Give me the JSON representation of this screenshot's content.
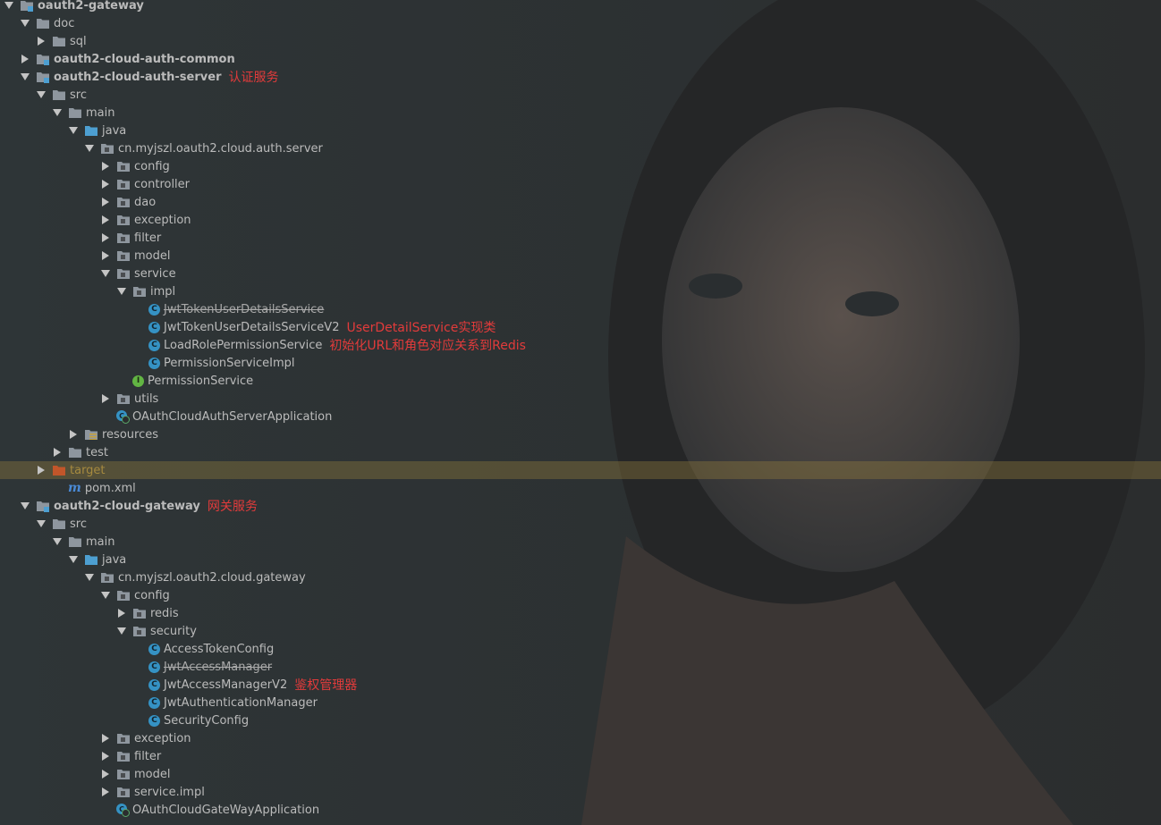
{
  "colors": {
    "annotation": "#e23b3b",
    "folder": "#8e969e",
    "source_folder": "#4d9fd1",
    "excluded_folder": "#c2562a",
    "class_icon": "#3592c4",
    "interface_icon": "#62b543",
    "selected_row": "#7d6b3c"
  },
  "tree": [
    {
      "label": "oauth2-gateway",
      "depth": 0,
      "arrow": "down",
      "icon": "module-folder-icon",
      "bold": true
    },
    {
      "label": "doc",
      "depth": 1,
      "arrow": "down",
      "icon": "folder-icon"
    },
    {
      "label": "sql",
      "depth": 2,
      "arrow": "right",
      "icon": "folder-icon"
    },
    {
      "label": "oauth2-cloud-auth-common",
      "depth": 1,
      "arrow": "right",
      "icon": "module-folder-icon",
      "bold": true
    },
    {
      "label": "oauth2-cloud-auth-server",
      "depth": 1,
      "arrow": "down",
      "icon": "module-folder-icon",
      "bold": true,
      "note": "认证服务"
    },
    {
      "label": "src",
      "depth": 2,
      "arrow": "down",
      "icon": "folder-icon"
    },
    {
      "label": "main",
      "depth": 3,
      "arrow": "down",
      "icon": "folder-icon"
    },
    {
      "label": "java",
      "depth": 4,
      "arrow": "down",
      "icon": "source-folder-icon"
    },
    {
      "label": "cn.myjszl.oauth2.cloud.auth.server",
      "depth": 5,
      "arrow": "down",
      "icon": "package-icon"
    },
    {
      "label": "config",
      "depth": 6,
      "arrow": "right",
      "icon": "package-icon"
    },
    {
      "label": "controller",
      "depth": 6,
      "arrow": "right",
      "icon": "package-icon"
    },
    {
      "label": "dao",
      "depth": 6,
      "arrow": "right",
      "icon": "package-icon"
    },
    {
      "label": "exception",
      "depth": 6,
      "arrow": "right",
      "icon": "package-icon"
    },
    {
      "label": "filter",
      "depth": 6,
      "arrow": "right",
      "icon": "package-icon"
    },
    {
      "label": "model",
      "depth": 6,
      "arrow": "right",
      "icon": "package-icon"
    },
    {
      "label": "service",
      "depth": 6,
      "arrow": "down",
      "icon": "package-icon"
    },
    {
      "label": "impl",
      "depth": 7,
      "arrow": "down",
      "icon": "package-icon"
    },
    {
      "label": "JwtTokenUserDetailsService",
      "depth": 8,
      "arrow": "none",
      "icon": "class-icon",
      "strike": true
    },
    {
      "label": "JwtTokenUserDetailsServiceV2",
      "depth": 8,
      "arrow": "none",
      "icon": "class-icon",
      "note": "UserDetailService实现类"
    },
    {
      "label": "LoadRolePermissionService",
      "depth": 8,
      "arrow": "none",
      "icon": "class-icon",
      "note": "初始化URL和角色对应关系到Redis"
    },
    {
      "label": "PermissionServiceImpl",
      "depth": 8,
      "arrow": "none",
      "icon": "class-icon"
    },
    {
      "label": "PermissionService",
      "depth": 7,
      "arrow": "none",
      "icon": "interface-icon"
    },
    {
      "label": "utils",
      "depth": 6,
      "arrow": "right",
      "icon": "package-icon"
    },
    {
      "label": "OAuthCloudAuthServerApplication",
      "depth": 6,
      "arrow": "none",
      "icon": "spring-app-icon"
    },
    {
      "label": "resources",
      "depth": 4,
      "arrow": "right",
      "icon": "resources-folder-icon"
    },
    {
      "label": "test",
      "depth": 3,
      "arrow": "right",
      "icon": "folder-icon"
    },
    {
      "label": "target",
      "depth": 2,
      "arrow": "right",
      "icon": "excluded-folder-icon",
      "orange": true,
      "selected": true
    },
    {
      "label": "pom.xml",
      "depth": 3,
      "arrow": "none",
      "icon": "maven-icon"
    },
    {
      "label": "oauth2-cloud-gateway",
      "depth": 1,
      "arrow": "down",
      "icon": "module-folder-icon",
      "bold": true,
      "note": "网关服务"
    },
    {
      "label": "src",
      "depth": 2,
      "arrow": "down",
      "icon": "folder-icon"
    },
    {
      "label": "main",
      "depth": 3,
      "arrow": "down",
      "icon": "folder-icon"
    },
    {
      "label": "java",
      "depth": 4,
      "arrow": "down",
      "icon": "source-folder-icon"
    },
    {
      "label": "cn.myjszl.oauth2.cloud.gateway",
      "depth": 5,
      "arrow": "down",
      "icon": "package-icon"
    },
    {
      "label": "config",
      "depth": 6,
      "arrow": "down",
      "icon": "package-icon"
    },
    {
      "label": "redis",
      "depth": 7,
      "arrow": "right",
      "icon": "package-icon"
    },
    {
      "label": "security",
      "depth": 7,
      "arrow": "down",
      "icon": "package-icon"
    },
    {
      "label": "AccessTokenConfig",
      "depth": 8,
      "arrow": "none",
      "icon": "class-icon"
    },
    {
      "label": "JwtAccessManager",
      "depth": 8,
      "arrow": "none",
      "icon": "class-icon",
      "strike": true
    },
    {
      "label": "JwtAccessManagerV2",
      "depth": 8,
      "arrow": "none",
      "icon": "class-icon",
      "note": "鉴权管理器"
    },
    {
      "label": "JwtAuthenticationManager",
      "depth": 8,
      "arrow": "none",
      "icon": "class-icon"
    },
    {
      "label": "SecurityConfig",
      "depth": 8,
      "arrow": "none",
      "icon": "class-icon"
    },
    {
      "label": "exception",
      "depth": 6,
      "arrow": "right",
      "icon": "package-icon"
    },
    {
      "label": "filter",
      "depth": 6,
      "arrow": "right",
      "icon": "package-icon"
    },
    {
      "label": "model",
      "depth": 6,
      "arrow": "right",
      "icon": "package-icon"
    },
    {
      "label": "service.impl",
      "depth": 6,
      "arrow": "right",
      "icon": "package-icon"
    },
    {
      "label": "OAuthCloudGateWayApplication",
      "depth": 6,
      "arrow": "none",
      "icon": "spring-app-icon"
    }
  ]
}
